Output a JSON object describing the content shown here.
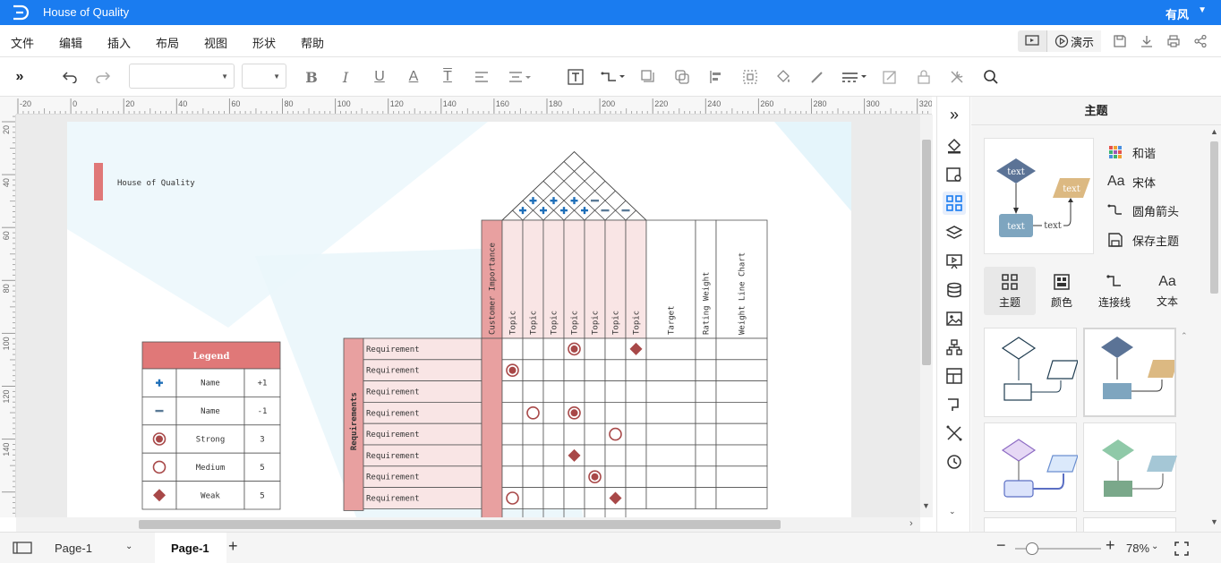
{
  "app": {
    "title": "House of Quality",
    "user": "有风"
  },
  "menu": [
    "文件",
    "编辑",
    "插入",
    "布局",
    "视图",
    "形状",
    "帮助"
  ],
  "present_label": "演示",
  "ruler": {
    "top": [
      "-20",
      "0",
      "20",
      "40",
      "60",
      "80",
      "100",
      "120",
      "140",
      "160",
      "180",
      "200",
      "220",
      "240",
      "260",
      "280",
      "300",
      "320"
    ],
    "left": [
      "20",
      "40",
      "60",
      "80",
      "100",
      "120",
      "140"
    ]
  },
  "diagram": {
    "title": "House of Quality",
    "legend": {
      "header": "Legend",
      "rows": [
        {
          "symbol": "plus",
          "name": "Name",
          "value": "+1"
        },
        {
          "symbol": "minus",
          "name": "Name",
          "value": "-1"
        },
        {
          "symbol": "strong",
          "name": "Strong",
          "value": "3"
        },
        {
          "symbol": "medium",
          "name": "Medium",
          "value": "5"
        },
        {
          "symbol": "weak",
          "name": "Weak",
          "value": "5"
        }
      ]
    },
    "columns": [
      "Customer Importance",
      "Topic",
      "Topic",
      "Topic",
      "Topic",
      "Topic",
      "Topic",
      "Topic",
      "Target",
      "Rating Weight",
      "Weight Line Chart"
    ],
    "requirements_label": "Requirements",
    "requirements": [
      "Requirement",
      "Requirement",
      "Requirement",
      "Requirement",
      "Requirement",
      "Requirement",
      "Requirement",
      "Requirement"
    ],
    "matrix": [
      {
        "row": 0,
        "col": 3,
        "symbol": "strong"
      },
      {
        "row": 0,
        "col": 6,
        "symbol": "weak"
      },
      {
        "row": 1,
        "col": 0,
        "symbol": "strong"
      },
      {
        "row": 3,
        "col": 1,
        "symbol": "medium"
      },
      {
        "row": 3,
        "col": 3,
        "symbol": "strong"
      },
      {
        "row": 4,
        "col": 5,
        "symbol": "medium"
      },
      {
        "row": 5,
        "col": 3,
        "symbol": "weak"
      },
      {
        "row": 6,
        "col": 4,
        "symbol": "strong"
      },
      {
        "row": 7,
        "col": 0,
        "symbol": "medium"
      },
      {
        "row": 7,
        "col": 5,
        "symbol": "weak"
      }
    ],
    "roof": [
      {
        "i": 1,
        "j": 3,
        "symbol": "plus"
      },
      {
        "i": 2,
        "j": 3,
        "symbol": "plus"
      },
      {
        "i": 3,
        "j": 5,
        "symbol": "minus"
      },
      {
        "i": 0,
        "j": 1,
        "symbol": "plus"
      },
      {
        "i": 1,
        "j": 2,
        "symbol": "plus"
      },
      {
        "i": 2,
        "j": 4,
        "symbol": "plus"
      },
      {
        "i": 4,
        "j": 5,
        "symbol": "minus"
      },
      {
        "i": 5,
        "j": 6,
        "symbol": "minus"
      },
      {
        "i": 0,
        "j": 2,
        "symbol": "plus"
      },
      {
        "i": 3,
        "j": 4,
        "symbol": "plus"
      }
    ]
  },
  "sidebar_icons": [
    "expand-icon",
    "fill-icon",
    "image-edit-icon",
    "theme-icon",
    "layers-icon",
    "presentation-icon",
    "database-icon",
    "picture-icon",
    "org-chart-icon",
    "table-icon",
    "connector-icon",
    "crossing-icon",
    "history-icon"
  ],
  "panel": {
    "title": "主题",
    "preview_labels": {
      "node": "text",
      "decision": "text",
      "side": "text",
      "line": "text"
    },
    "options": [
      "和谐",
      "宋体",
      "圆角箭头",
      "保存主题"
    ],
    "tabs": [
      "主题",
      "颜色",
      "连接线",
      "文本"
    ]
  },
  "status": {
    "page_selector": "Page-1",
    "page_tab": "Page-1",
    "zoom": "78%"
  },
  "colors": {
    "accent": "#1a7cf0",
    "header_red": "#e07878",
    "cell_pink": "#f9e5e5",
    "column_red": "#e8a0a0",
    "symbol_red": "#a84848",
    "roof_blue": "#1f6fb8"
  }
}
